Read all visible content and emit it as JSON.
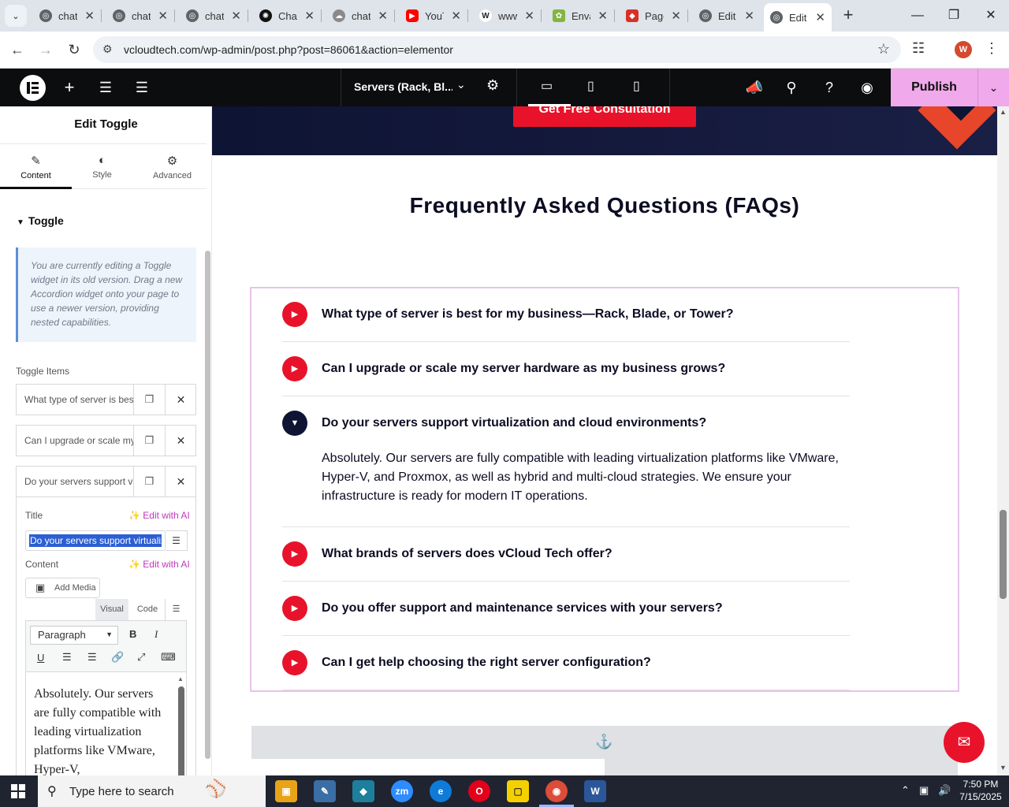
{
  "browser": {
    "tabs": [
      {
        "label": "chat",
        "icon": "globe-icon",
        "color": "#5f6368"
      },
      {
        "label": "chat",
        "icon": "globe-icon",
        "color": "#5f6368"
      },
      {
        "label": "chat",
        "icon": "globe-icon",
        "color": "#5f6368"
      },
      {
        "label": "Chat",
        "icon": "openai-icon",
        "color": "#111111"
      },
      {
        "label": "chat",
        "icon": "cloud-icon",
        "color": "#8a8a8a"
      },
      {
        "label": "YouT",
        "icon": "youtube-icon",
        "color": "#ff0000"
      },
      {
        "label": "www",
        "icon": "w-icon",
        "color": "#222222"
      },
      {
        "label": "Enva",
        "icon": "envato-icon",
        "color": "#82b541"
      },
      {
        "label": "Page",
        "icon": "gem-icon",
        "color": "#d93025"
      },
      {
        "label": "Edit",
        "icon": "globe-icon",
        "color": "#5f6368"
      },
      {
        "label": "Edit",
        "icon": "globe-icon",
        "color": "#5f6368",
        "active": true
      }
    ],
    "url": "vcloudtech.com/wp-admin/post.php?post=86061&action=elementor",
    "profile_initial": "W"
  },
  "editor_bar": {
    "page_name": "Servers (Rack, Bl...",
    "publish_label": "Publish"
  },
  "panel": {
    "title": "Edit Toggle",
    "tabs": [
      {
        "label": "Content",
        "icon": "pencil-icon"
      },
      {
        "label": "Style",
        "icon": "half-circle-icon"
      },
      {
        "label": "Advanced",
        "icon": "gear-icon"
      }
    ],
    "section_title": "Toggle",
    "notice": "You are currently editing a Toggle widget in its old version. Drag a new Accordion widget onto your page to use a newer version, providing nested capabilities.",
    "items_label": "Toggle Items",
    "items": [
      "What type of server is best for my business—Rack, Blade, or Tower?",
      "Can I upgrade or scale my server hardware as my business grows?",
      "Do your servers support virtualization and cloud environments?"
    ],
    "title_label": "Title",
    "title_value": "Do your servers support virtualization and cloud environments?",
    "edit_with_ai": "Edit with AI",
    "content_label": "Content",
    "add_media": "Add Media",
    "editor_tabs": [
      "Visual",
      "Code"
    ],
    "format_select": "Paragraph",
    "editor_text": "Absolutely. Our servers are fully compatible with leading virtualization platforms like VMware, Hyper-V,"
  },
  "canvas": {
    "cta_label": "Get Free Consultation",
    "faq_title": "Frequently Asked Questions (FAQs)",
    "faqs": [
      {
        "q": "What type of server is best for my business—Rack, Blade, or Tower?"
      },
      {
        "q": "Can I upgrade or scale my server hardware as my business grows?"
      },
      {
        "q": "Do your servers support virtualization and cloud environments?",
        "open": true
      },
      {
        "q": "What brands of servers does vCloud Tech offer?"
      },
      {
        "q": "Do you offer support and maintenance services with your servers?"
      },
      {
        "q": "Can I get help choosing the right server configuration?"
      }
    ],
    "answer": "Absolutely. Our servers are fully compatible with leading virtualization platforms like VMware, Hyper-V, and Proxmox, as well as hybrid and multi-cloud strategies. We ensure your infrastructure is ready for modern IT operations."
  },
  "taskbar": {
    "search_placeholder": "Type here to search",
    "time": "7:50 PM",
    "date": "7/15/2025"
  },
  "colors": {
    "accent_red": "#e8132a",
    "publish_pink": "#f0a9ea",
    "navy": "#0e1433"
  }
}
